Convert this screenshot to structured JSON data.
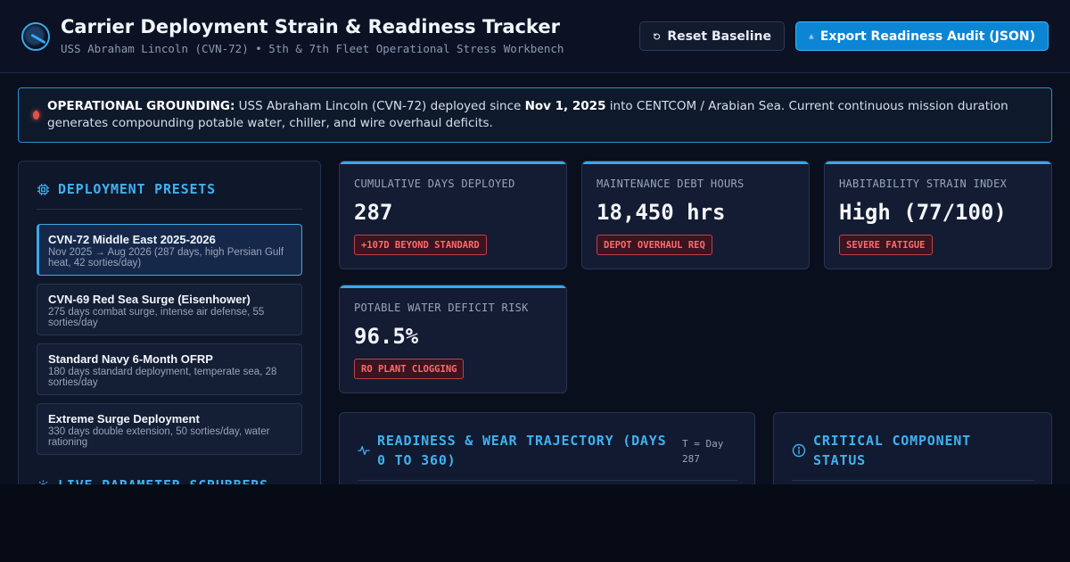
{
  "header": {
    "title": "Carrier Deployment Strain & Readiness Tracker",
    "subtitle": "USS Abraham Lincoln (CVN-72) • 5th & 7th Fleet Operational Stress Workbench",
    "reset_label": "Reset Baseline",
    "export_label": "Export Readiness Audit (JSON)",
    "logo_icon": "carrier-radar-icon"
  },
  "banner": {
    "label": "OPERATIONAL GROUNDING:",
    "text_1": " USS Abraham Lincoln (CVN-72) deployed since ",
    "date": "Nov 1, 2025",
    "text_2": " into CENTCOM / Arabian Sea. Current continuous mission duration generates compounding potable water, chiller, and wire overhaul deficits.",
    "status_color": "#e0524a"
  },
  "presets": {
    "title": "DEPLOYMENT PRESETS",
    "items": [
      {
        "name": "CVN-72 Middle East 2025-2026",
        "desc": "Nov 2025 → Aug 2026 (287 days, high Persian Gulf heat, 42 sorties/day)",
        "active": true
      },
      {
        "name": "CVN-69 Red Sea Surge (Eisenhower)",
        "desc": "275 days combat surge, intense air defense, 55 sorties/day",
        "active": false
      },
      {
        "name": "Standard Navy 6-Month OFRP",
        "desc": "180 days standard deployment, temperate sea, 28 sorties/day",
        "active": false
      },
      {
        "name": "Extreme Surge Deployment",
        "desc": "330 days double extension, 50 sorties/day, water rationing",
        "active": false
      }
    ]
  },
  "scrubbers": {
    "title": "LIVE PARAMETER SCRUBBERS"
  },
  "metrics": [
    {
      "label": "CUMULATIVE DAYS DEPLOYED",
      "value": "287",
      "badge": "+107D BEYOND STANDARD"
    },
    {
      "label": "MAINTENANCE DEBT HOURS",
      "value": "18,450 hrs",
      "badge": "DEPOT OVERHAUL REQ"
    },
    {
      "label": "HABITABILITY STRAIN INDEX",
      "value": "High (77/100)",
      "badge": "SEVERE FATIGUE"
    },
    {
      "label": "POTABLE WATER DEFICIT RISK",
      "value": "96.5%",
      "badge": "RO PLANT CLOGGING"
    }
  ],
  "trajectory": {
    "title": "READINESS & WEAR TRAJECTORY (DAYS 0 TO 360)",
    "day_marker": "T = Day 287"
  },
  "status": {
    "title": "CRITICAL COMPONENT STATUS"
  },
  "colors": {
    "accent": "#3fb2f0",
    "alert": "#ff6b6b",
    "background": "#0a0f1e"
  }
}
